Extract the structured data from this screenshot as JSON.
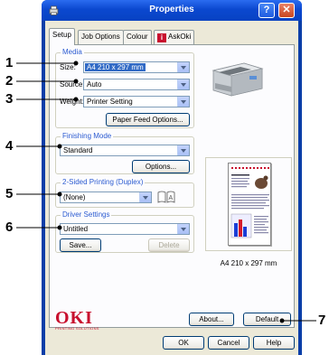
{
  "window": {
    "title": "Properties",
    "help_label": "?",
    "close_label": "✕"
  },
  "tabs": [
    {
      "label": "Setup",
      "active": true
    },
    {
      "label": "Job Options",
      "active": false
    },
    {
      "label": "Colour",
      "active": false
    },
    {
      "label": "AskOki",
      "active": false,
      "icon": "oki-red-i-icon"
    }
  ],
  "media": {
    "legend": "Media",
    "size_label": "Size:",
    "size_value": "A4 210 x 297 mm",
    "source_label": "Source:",
    "source_value": "Auto",
    "weight_label": "Weight:",
    "weight_value": "Printer Setting",
    "paper_feed_button": "Paper Feed Options..."
  },
  "finishing": {
    "legend": "Finishing Mode",
    "value": "Standard",
    "options_button": "Options..."
  },
  "duplex": {
    "legend": "2-Sided Printing (Duplex)",
    "value": "(None)"
  },
  "driver": {
    "legend": "Driver Settings",
    "value": "Untitled",
    "save_button": "Save...",
    "delete_button": "Delete"
  },
  "preview": {
    "page_size": "A4 210 x 297 mm"
  },
  "logo": {
    "main": "OKI",
    "sub": "PRINTING SOLUTIONS"
  },
  "buttons": {
    "about": "About...",
    "default": "Default",
    "ok": "OK",
    "cancel": "Cancel",
    "help": "Help"
  },
  "callouts": [
    "1",
    "2",
    "3",
    "4",
    "5",
    "6",
    "7"
  ]
}
